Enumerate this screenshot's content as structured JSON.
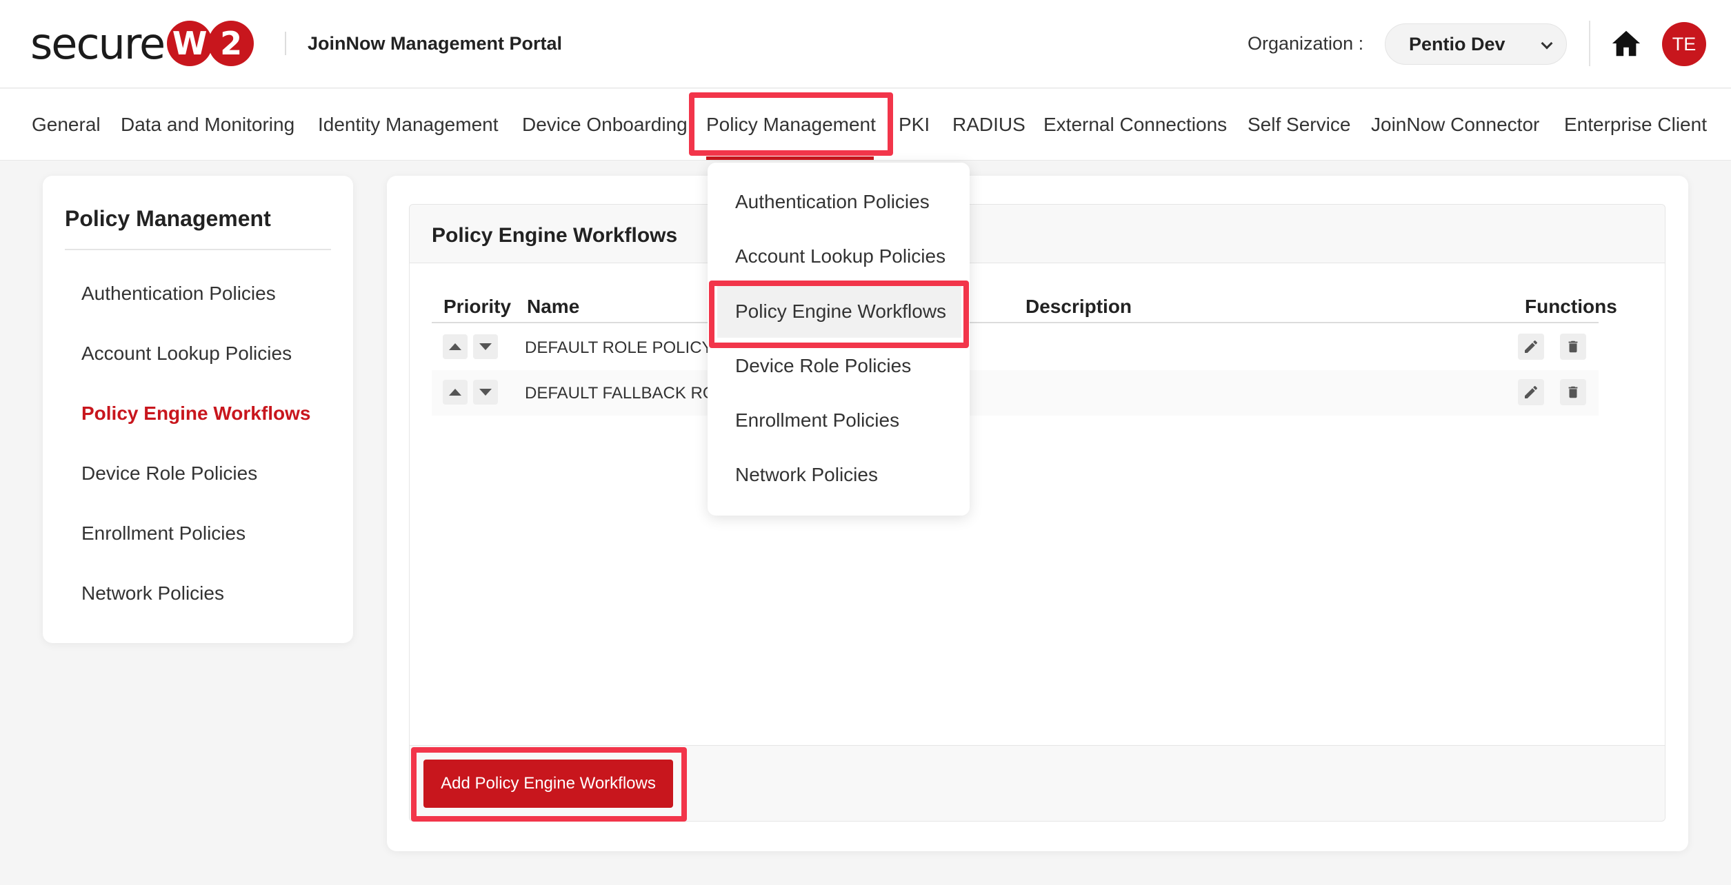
{
  "header": {
    "logo_text": "secure",
    "logo_badge_1": "W",
    "logo_badge_2": "2",
    "portal_title": "JoinNow Management Portal",
    "org_label": "Organization :",
    "org_value": "Pentio Dev",
    "avatar_initials": "TE",
    "brand_color": "#c8161d"
  },
  "nav": {
    "items": [
      "General",
      "Data and Monitoring",
      "Identity Management",
      "Device Onboarding",
      "Policy Management",
      "PKI",
      "RADIUS",
      "External Connections",
      "Self Service",
      "JoinNow Connector",
      "Enterprise Client"
    ],
    "active": "Policy Management"
  },
  "dropdown": {
    "items": [
      "Authentication Policies",
      "Account Lookup Policies",
      "Policy Engine Workflows",
      "Device Role Policies",
      "Enrollment Policies",
      "Network Policies"
    ],
    "highlighted": "Policy Engine Workflows"
  },
  "sidebar": {
    "title": "Policy Management",
    "items": [
      "Authentication Policies",
      "Account Lookup Policies",
      "Policy Engine Workflows",
      "Device Role Policies",
      "Enrollment Policies",
      "Network Policies"
    ],
    "active": "Policy Engine Workflows"
  },
  "main": {
    "panel_title": "Policy Engine Workflows",
    "columns": [
      "Priority",
      "Name",
      "Description",
      "Functions"
    ],
    "rows": [
      {
        "name": "DEFAULT ROLE POLICY 1",
        "description": ""
      },
      {
        "name": "DEFAULT FALLBACK ROL",
        "description": ""
      }
    ],
    "add_button": "Add Policy Engine Workflows"
  },
  "icons": {
    "home": "home-icon",
    "edit": "pencil-icon",
    "delete": "trash-icon",
    "up": "arrow-up-icon",
    "down": "arrow-down-icon",
    "chevron": "chevron-down-icon"
  },
  "highlight_color": "#f2354a"
}
